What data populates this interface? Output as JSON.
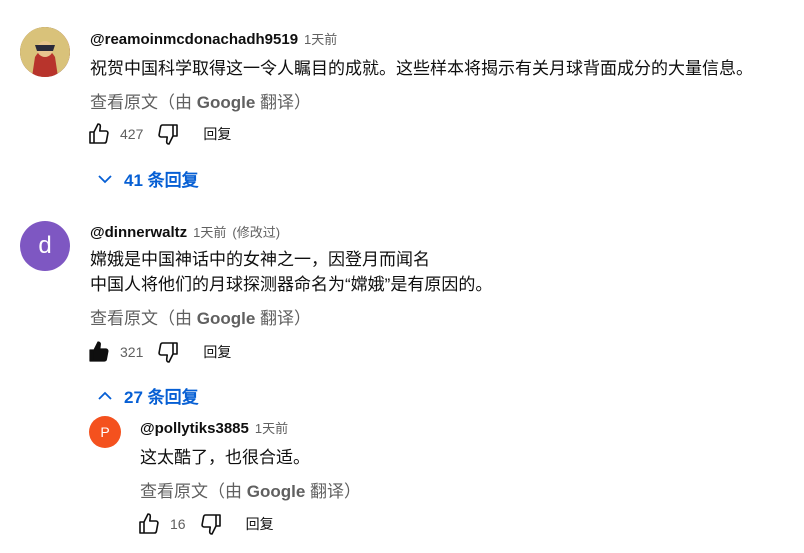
{
  "comments": [
    {
      "author": "@reamoinmcdonachadh9519",
      "time": "1天前",
      "text_lines": [
        "祝贺中国科学取得这一令人瞩目的成就。这些样本将揭示有关月球背面成分的大量信息。"
      ],
      "translate_prefix": "查看原文（由",
      "translate_brand": "Google",
      "translate_suffix": "翻译）",
      "likes": "427",
      "reply_label": "回复",
      "replies_toggle": "41 条回复"
    },
    {
      "author": "@dinnerwaltz",
      "time": "1天前",
      "edited": "(修改过)",
      "avatar_letter": "d",
      "avatar_color": "#7e57c2",
      "text_lines": [
        "嫦娥是中国神话中的女神之一，因登月而闻名",
        "中国人将他们的月球探测器命名为“嫦娥”是有原因的。"
      ],
      "translate_prefix": "查看原文（由",
      "translate_brand": "Google",
      "translate_suffix": "翻译）",
      "likes": "321",
      "reply_label": "回复",
      "replies_toggle": "27 条回复"
    },
    {
      "author": "@pollytiks3885",
      "time": "1天前",
      "avatar_letter": "P",
      "avatar_color": "#f4511e",
      "text_lines": [
        "这太酷了，也很合适。"
      ],
      "translate_prefix": "查看原文（由",
      "translate_brand": "Google",
      "translate_suffix": "翻译）",
      "likes": "16",
      "reply_label": "回复"
    }
  ]
}
